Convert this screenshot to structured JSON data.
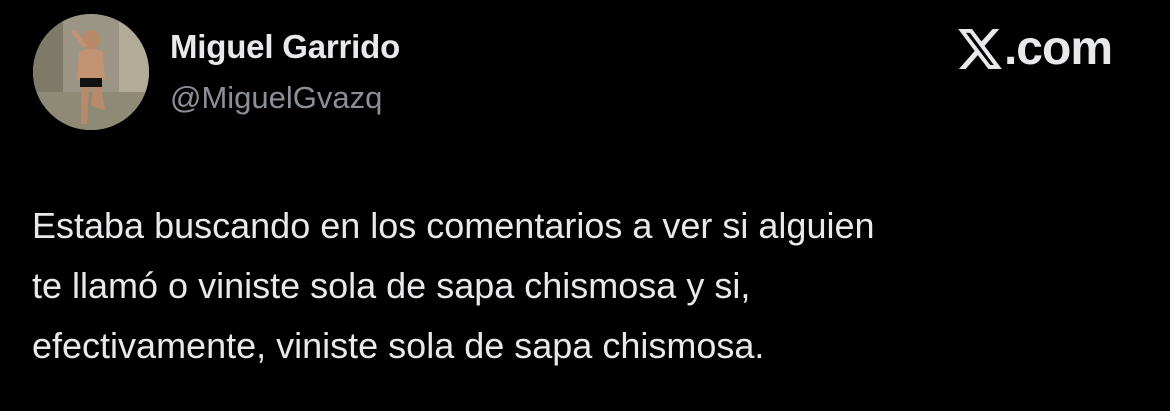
{
  "author": {
    "display_name": "Miguel Garrido",
    "handle": "@MiguelGvazq",
    "avatar_icon": "profile-photo"
  },
  "source": {
    "domain": ".com",
    "logo_icon": "x-logo-icon"
  },
  "tweet": {
    "lines": [
      "Estaba buscando en los comentarios a ver si alguien",
      "te llamó o viniste sola de sapa chismosa y si,",
      "efectivamente, viniste sola de sapa chismosa."
    ]
  },
  "colors": {
    "background": "#000000",
    "primary_text": "#e7e9ea",
    "secondary_text": "#8b9096"
  }
}
